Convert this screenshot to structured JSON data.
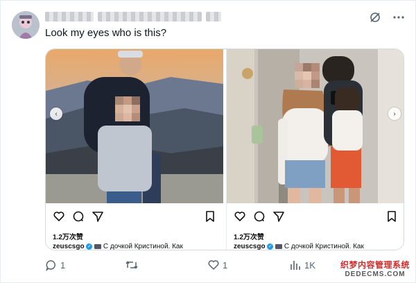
{
  "tweet": {
    "text": "Look my eyes who is this?",
    "header_icons": [
      "grok-icon",
      "more-icon"
    ]
  },
  "media": {
    "left_card": {
      "likes": "1.2万次赞",
      "caption_user": "zeuscsgo",
      "caption_text": "С дочкой Кристиной. Как"
    },
    "right_card": {
      "likes": "1.2万次赞",
      "caption_user": "zeuscsgo",
      "caption_text": "С дочкой Кристиной. Как"
    },
    "arrow_prev": "‹",
    "arrow_next": "›"
  },
  "footer": {
    "reply_count": "1",
    "retweet_count": "",
    "like_count": "1",
    "views_count": "1K"
  },
  "watermark": {
    "line1": "织梦内容管理系统",
    "line2": "DEDECMS.COM"
  },
  "colors": {
    "text": "#0f1419",
    "secondary": "#536471",
    "border": "#cfd9de",
    "verified": "#1d9bf0"
  }
}
